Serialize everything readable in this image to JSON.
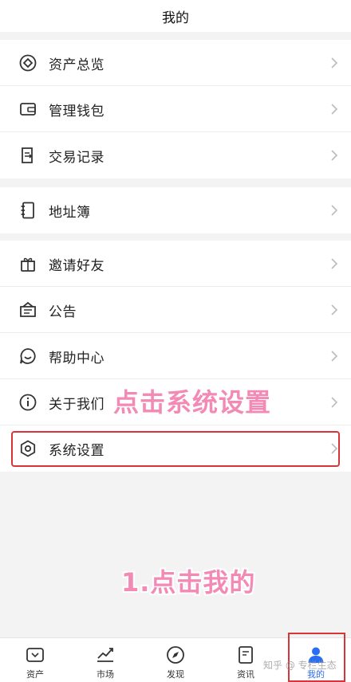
{
  "header": {
    "title": "我的"
  },
  "groups": [
    {
      "items": [
        {
          "label": "资产总览",
          "icon": "asset-overview-icon"
        },
        {
          "label": "管理钱包",
          "icon": "wallet-icon"
        },
        {
          "label": "交易记录",
          "icon": "transaction-record-icon"
        }
      ]
    },
    {
      "items": [
        {
          "label": "地址簿",
          "icon": "address-book-icon"
        }
      ]
    },
    {
      "items": [
        {
          "label": "邀请好友",
          "icon": "gift-icon"
        },
        {
          "label": "公告",
          "icon": "announcement-icon"
        },
        {
          "label": "帮助中心",
          "icon": "help-icon"
        },
        {
          "label": "关于我们",
          "icon": "info-icon"
        },
        {
          "label": "系统设置",
          "icon": "settings-icon"
        }
      ]
    }
  ],
  "annotations": {
    "settings_hint": "点击系统设置",
    "mine_hint": "1.点击我的"
  },
  "tabbar": {
    "tabs": [
      {
        "label": "资产",
        "icon": "asset-tab-icon"
      },
      {
        "label": "市场",
        "icon": "market-tab-icon"
      },
      {
        "label": "发现",
        "icon": "compass-icon"
      },
      {
        "label": "资讯",
        "icon": "news-tab-icon"
      },
      {
        "label": "我的",
        "icon": "user-icon",
        "active": true
      }
    ]
  },
  "watermark": "知乎 @ 专栏生态",
  "colors": {
    "accent": "#2a6df5",
    "highlight_box": "#d9343a",
    "annotation_text": "#f28ab5"
  }
}
